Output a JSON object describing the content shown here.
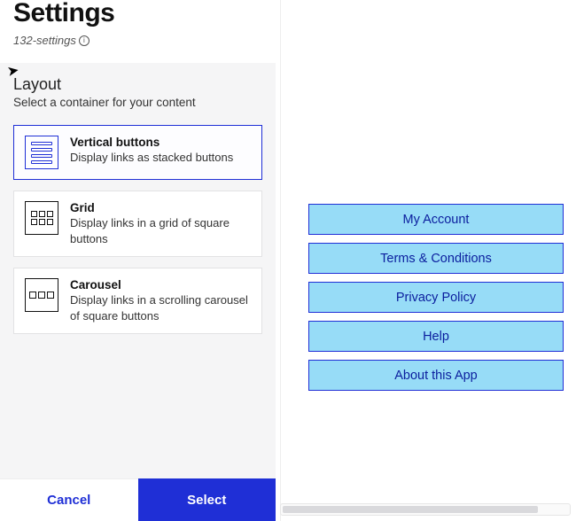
{
  "header": {
    "title": "Settings",
    "file_label": "132-settings"
  },
  "layout": {
    "title": "Layout",
    "subtitle": "Select a container for your content",
    "options": [
      {
        "title": "Vertical buttons",
        "desc": "Display links as stacked buttons",
        "selected": true
      },
      {
        "title": "Grid",
        "desc": "Display links in a grid of square buttons",
        "selected": false
      },
      {
        "title": "Carousel",
        "desc": "Display links in a scrolling carousel of square buttons",
        "selected": false
      }
    ]
  },
  "footer": {
    "cancel": "Cancel",
    "select": "Select"
  },
  "preview": {
    "buttons": [
      "My Account",
      "Terms & Conditions",
      "Privacy Policy",
      "Help",
      "About this App"
    ]
  }
}
